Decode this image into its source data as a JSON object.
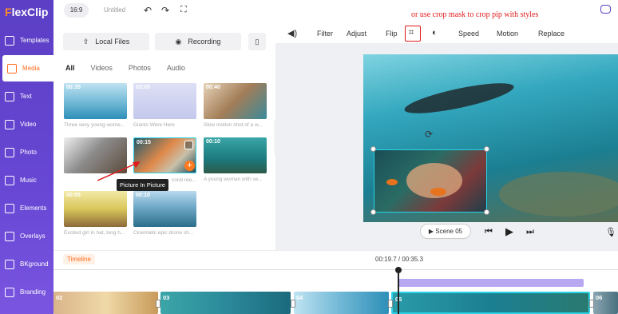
{
  "app": {
    "logo_f": "F",
    "logo_rest": "lexClip"
  },
  "header": {
    "ratio": "16:9",
    "project_title": "Untitled",
    "hint": "or use crop mask to crop pip with styles"
  },
  "sidebar": {
    "items": [
      {
        "label": "Templates"
      },
      {
        "label": "Media"
      },
      {
        "label": "Text"
      },
      {
        "label": "Video"
      },
      {
        "label": "Photo"
      },
      {
        "label": "Music"
      },
      {
        "label": "Elements"
      },
      {
        "label": "Overlays"
      },
      {
        "label": "BKground"
      },
      {
        "label": "Branding"
      }
    ]
  },
  "library": {
    "local_files": "Local Files",
    "recording": "Recording",
    "tabs": [
      "All",
      "Videos",
      "Photos",
      "Audio"
    ],
    "items": [
      {
        "duration": "00:35",
        "caption": "Three sexy young wome..."
      },
      {
        "duration": "03:05",
        "caption": "Giants Were Here"
      },
      {
        "duration": "00:40",
        "caption": "Slow motion shot of a w..."
      },
      {
        "duration": "",
        "caption": ""
      },
      {
        "duration": "00:15",
        "caption": "coral ree..."
      },
      {
        "duration": "00:10",
        "caption": "A young woman with se..."
      },
      {
        "duration": "00:05",
        "caption": "Excited girl in hat, long h..."
      },
      {
        "duration": "00:10",
        "caption": "Cinematic epic drone sh..."
      }
    ],
    "tooltip": "Picture In Picture"
  },
  "toolbar": {
    "filter": "Filter",
    "adjust": "Adjust",
    "flip": "Flip",
    "speed": "Speed",
    "motion": "Motion",
    "replace": "Replace"
  },
  "player": {
    "scene": "Scene 05"
  },
  "timeline": {
    "label": "Timeline",
    "time": "00:19.7 / 00:35.3",
    "clips": [
      {
        "num": "02"
      },
      {
        "num": "03"
      },
      {
        "num": "04"
      },
      {
        "num": "05"
      },
      {
        "num": "06"
      }
    ]
  },
  "colors": {
    "brand": "#5b3fc4",
    "accent": "#ff6d1f",
    "selection": "#2ad3e6",
    "hint": "#e01a1a"
  }
}
